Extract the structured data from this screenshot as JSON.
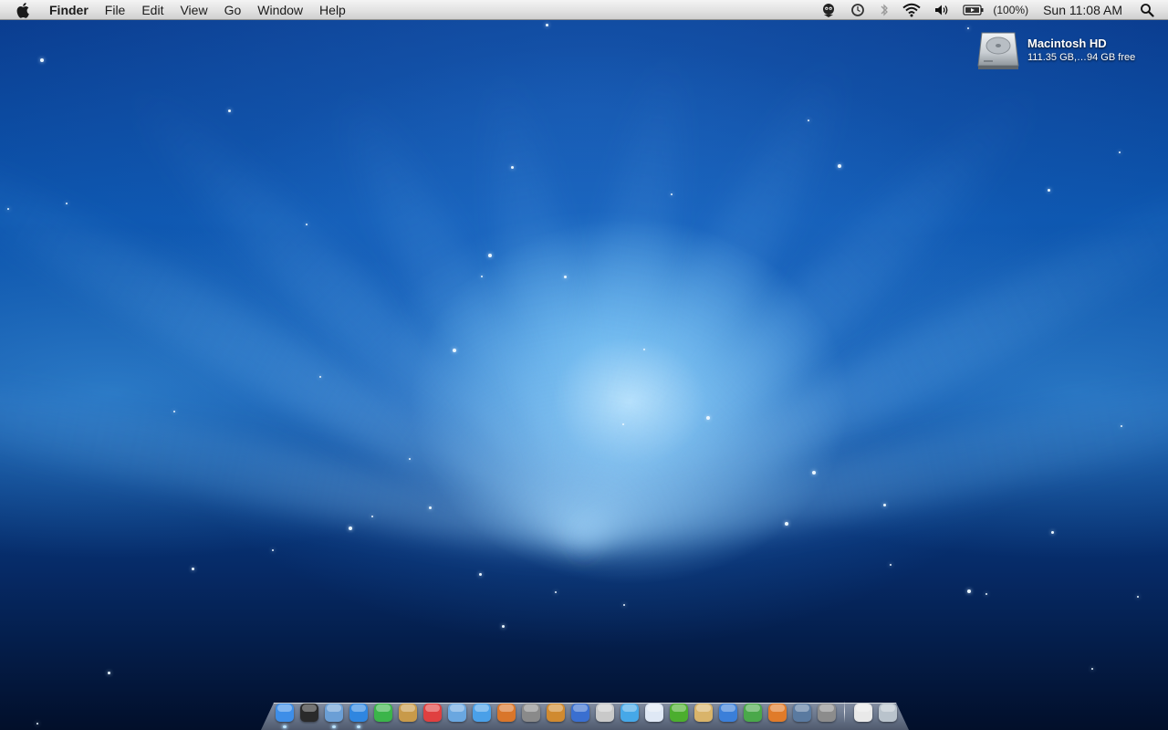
{
  "menubar": {
    "apple_icon": "apple-icon",
    "app_name": "Finder",
    "menus": [
      "File",
      "Edit",
      "View",
      "Go",
      "Window",
      "Help"
    ],
    "status": {
      "icons": [
        "growl-icon",
        "time-machine-icon",
        "bluetooth-icon",
        "wifi-icon",
        "volume-icon",
        "battery-icon"
      ],
      "battery_percent": "(100%)",
      "clock": "Sun 11:08 AM",
      "spotlight_icon": "spotlight-search-icon"
    }
  },
  "desktop": {
    "drive": {
      "icon": "hard-drive-icon",
      "name": "Macintosh HD",
      "info": "111.35 GB,…94 GB free"
    }
  },
  "dock": {
    "apps": [
      {
        "icon": "finder-icon",
        "color": "#3e8ee8",
        "running": true
      },
      {
        "icon": "dashboard-icon",
        "color": "#2a2a2a",
        "running": false
      },
      {
        "icon": "mail-icon",
        "color": "#6b9fd6",
        "running": true
      },
      {
        "icon": "safari-icon",
        "color": "#2f86e0",
        "running": true
      },
      {
        "icon": "adium-icon",
        "color": "#3bb54a",
        "running": false
      },
      {
        "icon": "address-book-icon",
        "color": "#c89a4a",
        "running": false
      },
      {
        "icon": "ical-icon",
        "color": "#e04040",
        "running": false
      },
      {
        "icon": "iphoto-icon",
        "color": "#6aa7e0",
        "running": false
      },
      {
        "icon": "itunes-icon",
        "color": "#4aa0e8",
        "running": false
      },
      {
        "icon": "image-capture-icon",
        "color": "#d9762b",
        "running": false
      },
      {
        "icon": "imovie-icon",
        "color": "#8a8a8a",
        "running": false
      },
      {
        "icon": "garageband-icon",
        "color": "#d08a30",
        "running": false
      },
      {
        "icon": "skype-icon",
        "color": "#3a6fd0",
        "running": false
      },
      {
        "icon": "preview-icon",
        "color": "#c9c9c9",
        "running": false
      },
      {
        "icon": "network-icon",
        "color": "#46a8e8",
        "running": false
      },
      {
        "icon": "textedit-icon",
        "color": "#dfe8f5",
        "running": false
      },
      {
        "icon": "leaf-icon",
        "color": "#4cae2e",
        "running": false
      },
      {
        "icon": "installer-icon",
        "color": "#d9b46a",
        "running": false
      },
      {
        "icon": "word-icon",
        "color": "#3b7fd9",
        "running": false
      },
      {
        "icon": "excel-icon",
        "color": "#4aa84a",
        "running": false
      },
      {
        "icon": "powerpoint-icon",
        "color": "#e07b2a",
        "running": false
      },
      {
        "icon": "spaces-icon",
        "color": "#5a7aa0",
        "running": false
      },
      {
        "icon": "system-preferences-icon",
        "color": "#8c8c8c",
        "running": false
      }
    ],
    "right": [
      {
        "icon": "documents-stack-icon",
        "color": "#e9e9e9",
        "running": false
      },
      {
        "icon": "trash-icon",
        "color": "#b9c3cc",
        "running": false
      }
    ]
  }
}
